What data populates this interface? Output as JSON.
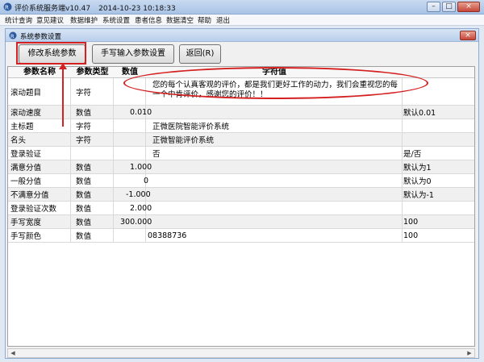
{
  "app": {
    "title": "评价系统服务端v10.47",
    "datetime": "2014-10-23 10:18:33",
    "controls": {
      "minimize": "–",
      "maximize": "□",
      "close": "×"
    }
  },
  "menu": [
    "统计查询",
    "意见建议",
    "数据维护",
    "系统设置",
    "患者信息",
    "数据清空",
    "帮助",
    "退出"
  ],
  "dialog": {
    "title": "系统参数设置",
    "close": "×",
    "buttons": {
      "modify": "修改系统参数",
      "handwrite": "手写输入参数设置",
      "back": "返回(R)"
    }
  },
  "grid": {
    "headers": [
      "参数名称",
      "参数类型",
      "数值",
      "字符值",
      ""
    ],
    "rows": [
      {
        "name": "滚动题目",
        "type": "字符",
        "num": "",
        "str": "您的每个认真客观的评价，都是我们更好工作的动力，我们会重视您的每一个中肯评价，感谢您的评价！！",
        "def": ""
      },
      {
        "name": "滚动速度",
        "type": "数值",
        "num": "0.010",
        "str": "",
        "def": "默认0.01"
      },
      {
        "name": "主标题",
        "type": "字符",
        "num": "",
        "str": "正微医院智能评价系统",
        "def": ""
      },
      {
        "name": "名头",
        "type": "字符",
        "num": "",
        "str": "正微智能评价系统",
        "def": ""
      },
      {
        "name": "登录验证",
        "type": "",
        "num": "",
        "str": "否",
        "def": "是/否"
      },
      {
        "name": "满意分值",
        "type": "数值",
        "num": "1.000",
        "str": "",
        "def": "默认为1"
      },
      {
        "name": "一般分值",
        "type": "数值",
        "num": "0",
        "str": "",
        "def": "默认为0"
      },
      {
        "name": "不满意分值",
        "type": "数值",
        "num": "-1.000",
        "str": "",
        "def": "默认为-1"
      },
      {
        "name": "登录验证次数",
        "type": "数值",
        "num": "2.000",
        "str": "",
        "def": ""
      },
      {
        "name": "手写宽度",
        "type": "数值",
        "num": "300.000",
        "str": "",
        "def": "100"
      },
      {
        "name": "手写颜色",
        "type": "数值",
        "num": "",
        "str": "08388736",
        "def": "100"
      }
    ]
  },
  "scrollbar": {
    "left": "◀",
    "right": "▶"
  },
  "colors": {
    "annotation": "#d42020",
    "titlebar": "#b9cfec"
  }
}
